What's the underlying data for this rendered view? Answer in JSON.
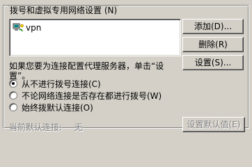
{
  "group": {
    "title": "拨号和虚拟专用网络设置 (N)"
  },
  "connections": [
    {
      "label": "vpn"
    }
  ],
  "buttons": {
    "add": "添加(D)...",
    "remove": "删除(R)",
    "settings": "设置(S)...",
    "set_default": "设置默认值(E)"
  },
  "hint": "如果您要为连接配置代理服务器，单击“设置”。",
  "radios": [
    {
      "label": "从不进行拨号连接(C)",
      "checked": true
    },
    {
      "label": "不论网络连接是否存在都进行拨号(W)",
      "checked": false
    },
    {
      "label": "始终拨默认连接(O)",
      "checked": false
    }
  ],
  "current_default": {
    "label": "当前默认连接:",
    "value": "无"
  },
  "icons": {
    "connection": "network-connection-icon"
  }
}
